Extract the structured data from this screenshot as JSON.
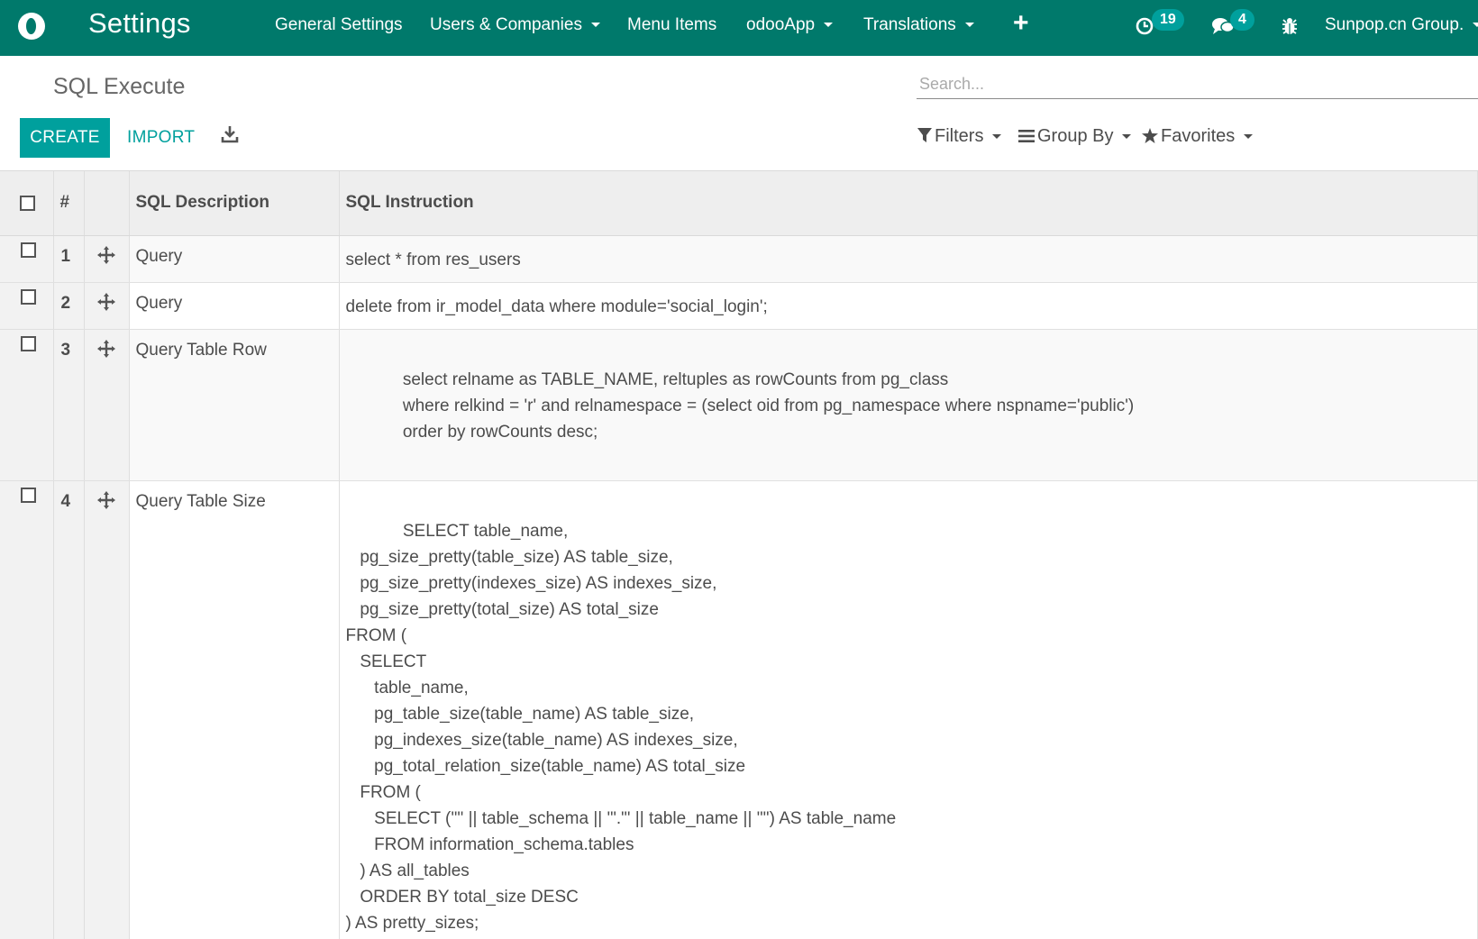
{
  "navbar": {
    "app_title": "Settings",
    "menu": [
      {
        "label": "General Settings"
      },
      {
        "label": "Users & Companies"
      },
      {
        "label": "Menu Items"
      },
      {
        "label": "odooApp"
      },
      {
        "label": "Translations"
      }
    ],
    "activity_count": "19",
    "messages_count": "4",
    "company": "Sunpop.cn Group."
  },
  "control_panel": {
    "breadcrumb": "SQL Execute",
    "search_placeholder": "Search...",
    "create_label": "CREATE",
    "import_label": "IMPORT",
    "filters_label": "Filters",
    "group_by_label": "Group By",
    "favorites_label": "Favorites"
  },
  "table": {
    "headers": {
      "number": "#",
      "description": "SQL Description",
      "instruction": "SQL Instruction"
    },
    "rows": [
      {
        "number": "1",
        "description": "Query",
        "instruction": "select * from res_users"
      },
      {
        "number": "2",
        "description": "Query",
        "instruction": "delete from ir_model_data where module='social_login';"
      },
      {
        "number": "3",
        "description": "Query Table Row",
        "instruction": "\n            select relname as TABLE_NAME, reltuples as rowCounts from pg_class\n            where relkind = 'r' and relnamespace = (select oid from pg_namespace where nspname='public')\n            order by rowCounts desc;\n "
      },
      {
        "number": "4",
        "description": "Query Table Size",
        "instruction": "\n            SELECT table_name,\n   pg_size_pretty(table_size) AS table_size,\n   pg_size_pretty(indexes_size) AS indexes_size,\n   pg_size_pretty(total_size) AS total_size\nFROM (\n   SELECT\n      table_name,\n      pg_table_size(table_name) AS table_size,\n      pg_indexes_size(table_name) AS indexes_size,\n      pg_total_relation_size(table_name) AS total_size\n   FROM (\n      SELECT ('\"' || table_schema || '\".\"' || table_name || '\"') AS table_name\n      FROM information_schema.tables\n   ) AS all_tables\n   ORDER BY total_size DESC\n) AS pretty_sizes;"
      }
    ]
  }
}
